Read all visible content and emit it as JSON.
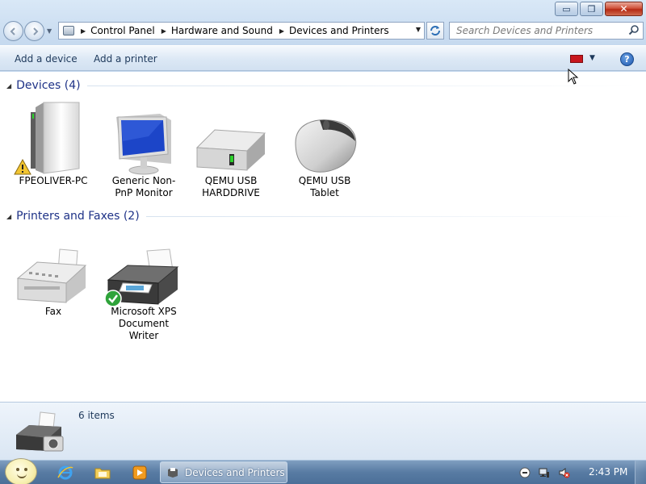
{
  "window": {
    "minimize_glyph": "▭",
    "maximize_glyph": "❐",
    "close_glyph": "✕"
  },
  "nav": {
    "breadcrumb": [
      "Control Panel",
      "Hardware and Sound",
      "Devices and Printers"
    ],
    "search_placeholder": "Search Devices and Printers",
    "back_icon": "back-arrow-icon",
    "forward_icon": "forward-arrow-icon"
  },
  "commands": {
    "add_device": "Add a device",
    "add_printer": "Add a printer",
    "help": "?"
  },
  "groups": {
    "devices": {
      "title": "Devices (4)",
      "items": [
        {
          "label": "FPEOLIVER-PC",
          "icon": "computer-tower-icon",
          "warning": true
        },
        {
          "label": "Generic Non-PnP Monitor",
          "icon": "monitor-icon"
        },
        {
          "label": "QEMU USB HARDDRIVE",
          "icon": "hard-drive-icon"
        },
        {
          "label": "QEMU USB Tablet",
          "icon": "mouse-icon"
        }
      ]
    },
    "printers": {
      "title": "Printers and Faxes (2)",
      "items": [
        {
          "label": "Fax",
          "icon": "fax-icon"
        },
        {
          "label": "Microsoft XPS Document Writer",
          "icon": "printer-icon",
          "default": true
        }
      ]
    }
  },
  "details": {
    "count": "6 items"
  },
  "taskbar": {
    "active_window": "Devices and Printers",
    "clock": "2:43 PM",
    "pinned": [
      "internet-explorer-icon",
      "folder-icon",
      "media-player-icon"
    ]
  },
  "colors": {
    "accent": "#1e3287",
    "taskbar": "#587ba3",
    "close_button": "#c8442b"
  }
}
